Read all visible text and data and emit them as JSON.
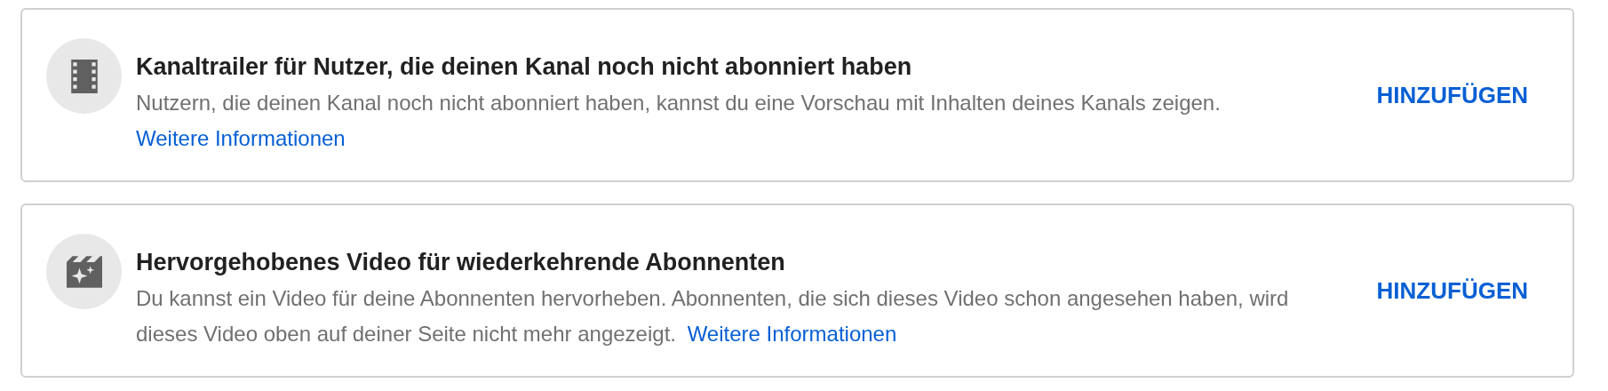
{
  "cards": [
    {
      "title": "Kanaltrailer für Nutzer, die deinen Kanal noch nicht abonniert haben",
      "description": "Nutzern, die deinen Kanal noch nicht abonniert haben, kannst du eine Vorschau mit Inhalten deines Kanals zeigen.",
      "link": "Weitere Informationen",
      "button": "HINZUFÜGEN"
    },
    {
      "title": "Hervorgehobenes Video für wiederkehrende Abonnenten",
      "description": "Du kannst ein Video für deine Abonnenten hervorheben. Abonnenten, die sich dieses Video schon angesehen haben, wird dieses Video oben auf deiner Seite nicht mehr angezeigt.",
      "link": "Weitere Informationen",
      "button": "HINZUFÜGEN"
    }
  ]
}
